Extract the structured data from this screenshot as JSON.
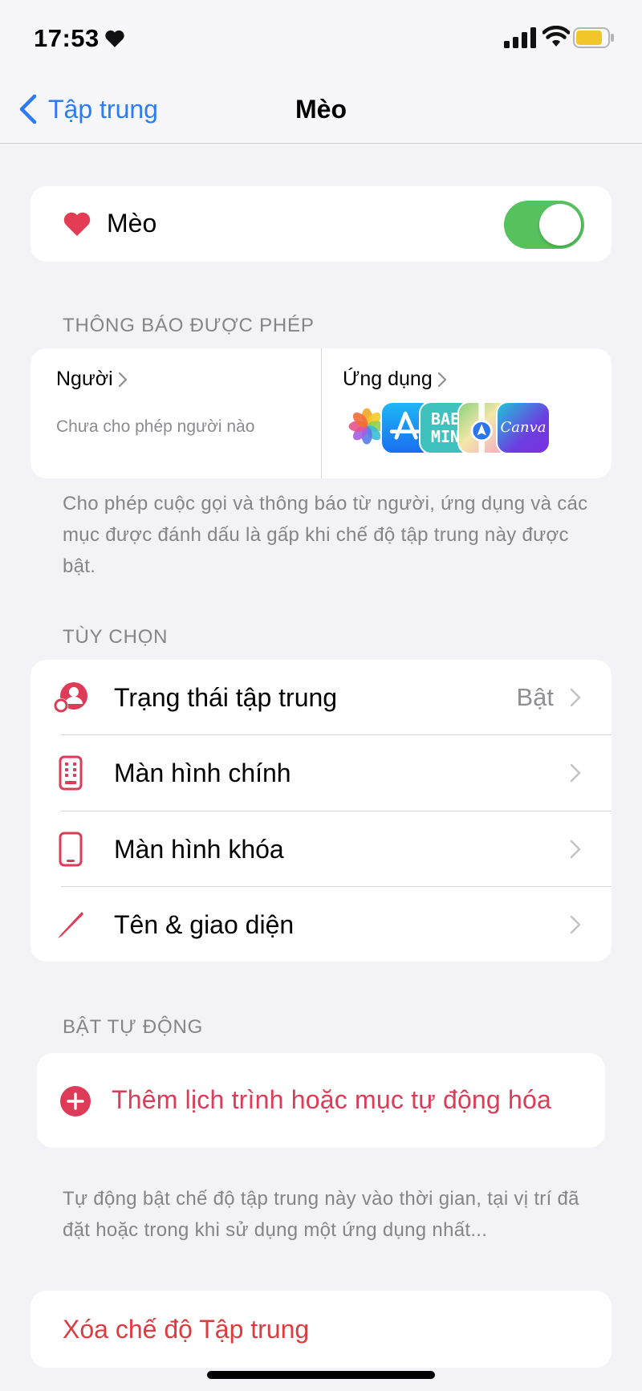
{
  "status_bar": {
    "time": "17:53"
  },
  "nav": {
    "back_label": "Tập trung",
    "title": "Mèo"
  },
  "focus": {
    "name": "Mèo",
    "enabled": true,
    "accent_color": "#e23d55",
    "toggle_color": "#56c25e"
  },
  "allowed_notifications": {
    "header": "THÔNG BÁO ĐƯỢC PHÉP",
    "people": {
      "title": "Người",
      "subtitle": "Chưa cho phép người nào"
    },
    "apps": {
      "title": "Ứng dụng",
      "icons": [
        "photos-app-icon",
        "app-store-icon",
        "baemin-app-icon",
        "maps-app-icon",
        "canva-app-icon"
      ],
      "icon_texts": {
        "baemin": "BAE MIN",
        "canva": "Canva"
      }
    },
    "footnote": "Cho phép cuộc gọi và thông báo từ người, ứng dụng và các mục được đánh dấu là gấp khi chế độ tập trung này được bật."
  },
  "options": {
    "header": "TÙY CHỌN",
    "items": [
      {
        "label": "Trạng thái tập trung",
        "value": "Bật",
        "icon": "focus-status-icon"
      },
      {
        "label": "Màn hình chính",
        "value": "",
        "icon": "home-screen-icon"
      },
      {
        "label": "Màn hình khóa",
        "value": "",
        "icon": "lock-screen-icon"
      },
      {
        "label": "Tên & giao diện",
        "value": "",
        "icon": "pencil-icon"
      }
    ]
  },
  "auto_on": {
    "header": "BẬT TỰ ĐỘNG",
    "add_label": "Thêm lịch trình hoặc mục tự động hóa",
    "footnote": "Tự động bật chế độ tập trung này vào thời gian, tại vị trí đã đặt hoặc trong khi sử dụng một ứng dụng nhất..."
  },
  "delete": {
    "label": "Xóa chế độ Tập trung"
  }
}
